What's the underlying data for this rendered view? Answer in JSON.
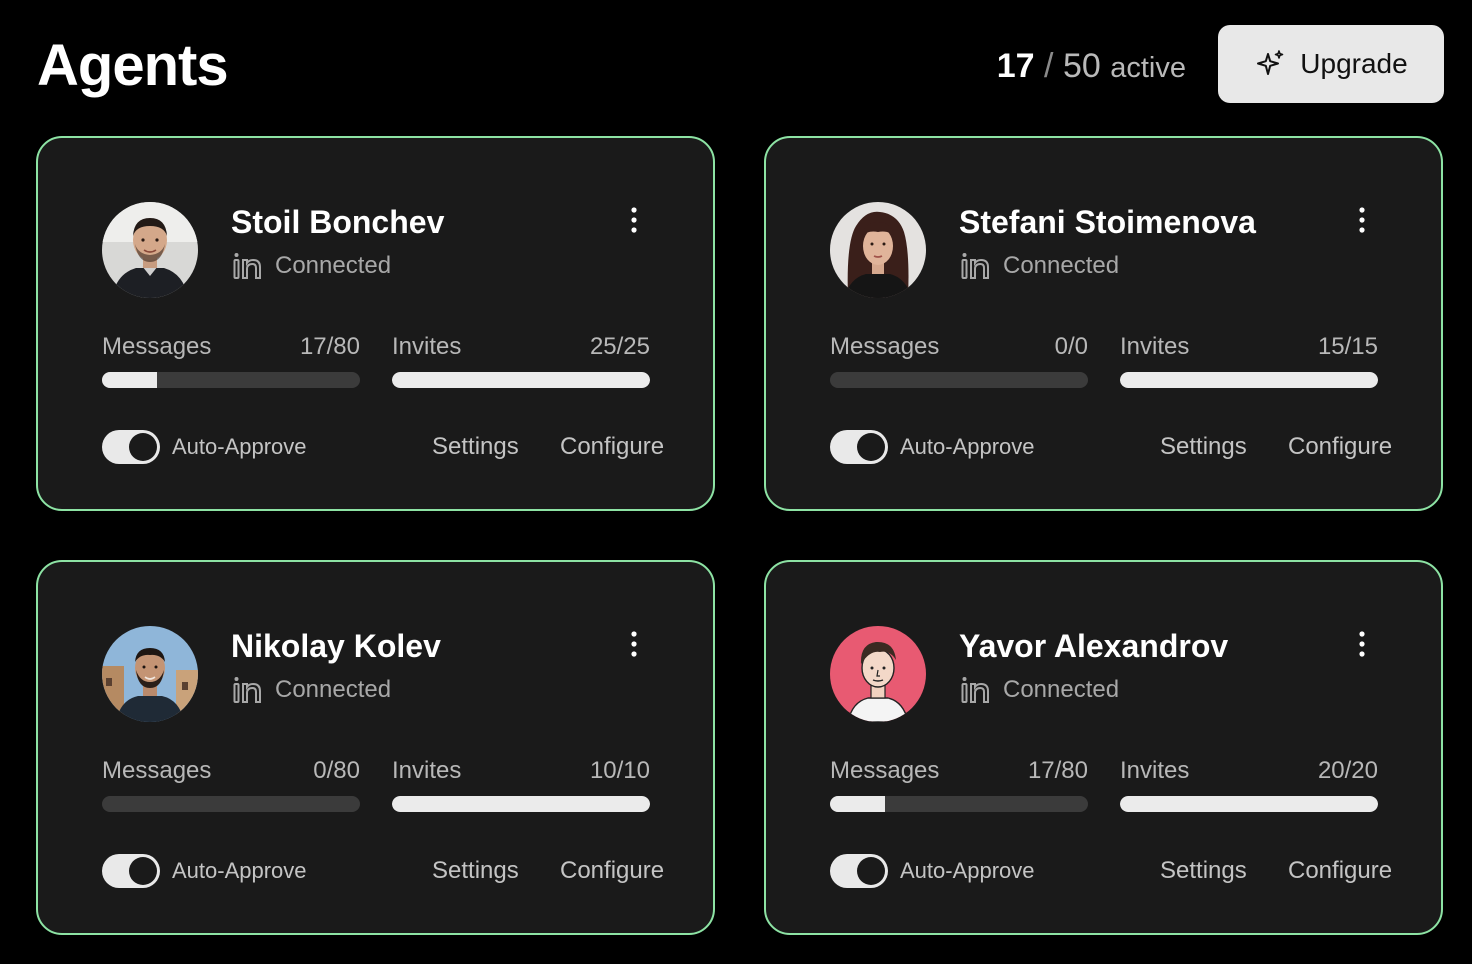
{
  "header": {
    "title": "Agents",
    "active_count": "17",
    "separator": "/",
    "active_total": "50",
    "active_word": "active",
    "upgrade_label": "Upgrade",
    "upgrade_icon": "sparkles-icon"
  },
  "colors": {
    "background": "#000000",
    "card_background": "#1a1a1a",
    "card_border": "#8de3a4",
    "progress_fill": "#ebebeb",
    "progress_track": "#3b3b3b",
    "toggle_on": "#e9e9e9"
  },
  "agents": [
    {
      "name": "Stoil Bonchev",
      "status": "Connected",
      "status_icon": "linkedin-icon",
      "messages_label": "Messages",
      "messages_value": "17/80",
      "messages_progress": 0.2125,
      "invites_label": "Invites",
      "invites_value": "25/25",
      "invites_progress": 1,
      "auto_approve_label": "Auto-Approve",
      "auto_approve_on": true,
      "settings_label": "Settings",
      "configure_label": "Configure"
    },
    {
      "name": "Stefani Stoimenova",
      "status": "Connected",
      "status_icon": "linkedin-icon",
      "messages_label": "Messages",
      "messages_value": "0/0",
      "messages_progress": 0,
      "invites_label": "Invites",
      "invites_value": "15/15",
      "invites_progress": 1,
      "auto_approve_label": "Auto-Approve",
      "auto_approve_on": true,
      "settings_label": "Settings",
      "configure_label": "Configure"
    },
    {
      "name": "Nikolay Kolev",
      "status": "Connected",
      "status_icon": "linkedin-icon",
      "messages_label": "Messages",
      "messages_value": "0/80",
      "messages_progress": 0,
      "invites_label": "Invites",
      "invites_value": "10/10",
      "invites_progress": 1,
      "auto_approve_label": "Auto-Approve",
      "auto_approve_on": true,
      "settings_label": "Settings",
      "configure_label": "Configure"
    },
    {
      "name": "Yavor Alexandrov",
      "status": "Connected",
      "status_icon": "linkedin-icon",
      "messages_label": "Messages",
      "messages_value": "17/80",
      "messages_progress": 0.2125,
      "invites_label": "Invites",
      "invites_value": "20/20",
      "invites_progress": 1,
      "auto_approve_label": "Auto-Approve",
      "auto_approve_on": true,
      "settings_label": "Settings",
      "configure_label": "Configure"
    }
  ]
}
